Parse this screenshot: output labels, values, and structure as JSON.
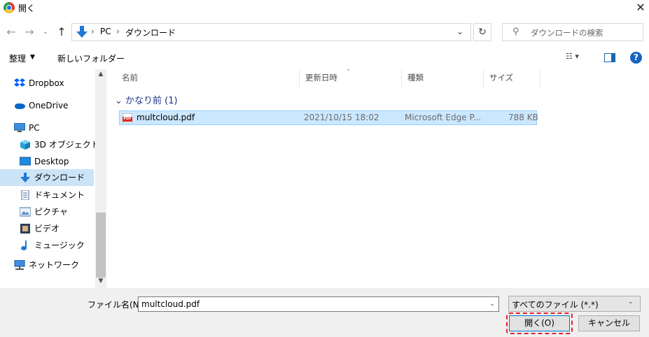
{
  "window": {
    "title": "開く"
  },
  "address": {
    "segments": [
      "PC",
      "ダウンロード"
    ]
  },
  "search": {
    "placeholder": "ダウンロードの検索"
  },
  "toolbar": {
    "organize_label": "整理",
    "new_folder_label": "新しいフォルダー"
  },
  "nav": {
    "items": [
      {
        "label": "Dropbox",
        "icon": "dropbox-icon"
      },
      {
        "label": "OneDrive",
        "icon": "onedrive-cloud-icon"
      },
      {
        "label": "PC",
        "icon": "pc-monitor-icon"
      },
      {
        "label": "3D オブジェクト",
        "icon": "3d-objects-icon"
      },
      {
        "label": "Desktop",
        "icon": "desktop-icon"
      },
      {
        "label": "ダウンロード",
        "icon": "download-arrow-icon",
        "selected": true
      },
      {
        "label": "ドキュメント",
        "icon": "document-icon"
      },
      {
        "label": "ピクチャ",
        "icon": "pictures-icon"
      },
      {
        "label": "ビデオ",
        "icon": "video-icon"
      },
      {
        "label": "ミュージック",
        "icon": "music-note-icon"
      },
      {
        "label": "ネットワーク",
        "icon": "network-icon"
      }
    ]
  },
  "columns": [
    "名前",
    "更新日時",
    "種類",
    "サイズ"
  ],
  "group": {
    "label": "かなり前 (1)"
  },
  "files": [
    {
      "name": "multcloud.pdf",
      "modified": "2021/10/15 18:02",
      "type": "Microsoft Edge P...",
      "size": "788 KB",
      "selected": true
    }
  ],
  "bottom": {
    "filename_label": "ファイル名(N):",
    "filename_value": "multcloud.pdf",
    "filetype_value": "すべてのファイル (*.*)",
    "open_label": "開く(O)",
    "cancel_label": "キャンセル"
  },
  "colors": {
    "accent": "#0078d7",
    "selection": "#cce8ff",
    "highlight_outline": "#e8202b",
    "group_header": "#1e3287"
  }
}
